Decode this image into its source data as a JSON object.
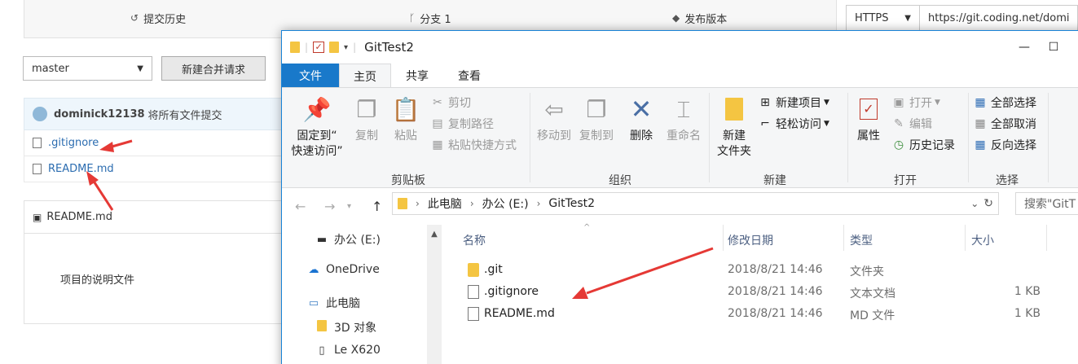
{
  "web": {
    "tabs": [
      {
        "icon": "history-icon",
        "label": "提交历史"
      },
      {
        "icon": "branch-icon",
        "label": "分支 1"
      },
      {
        "icon": "tag-icon",
        "label": "发布版本"
      }
    ],
    "clone": {
      "protocol": "HTTPS",
      "url": "https://git.coding.net/domi"
    },
    "branch_select": "master",
    "merge_request_button": "新建合并请求",
    "commit": {
      "user": "dominick12138",
      "message": "将所有文件提交"
    },
    "files": [
      ".gitignore",
      "README.md"
    ],
    "readme": {
      "title": "README.md",
      "body": "项目的说明文件"
    }
  },
  "explorer": {
    "title": "GitTest2",
    "window_buttons": {
      "minimize": "—",
      "maximize": "☐"
    },
    "ribbon_tabs": [
      "文件",
      "主页",
      "共享",
      "查看"
    ],
    "clipboard": {
      "pin_label_1": "固定到“",
      "pin_label_2": "快速访问”",
      "copy": "复制",
      "paste": "粘贴",
      "cut": "剪切",
      "copy_path": "复制路径",
      "paste_shortcut": "粘贴快捷方式",
      "group": "剪贴板"
    },
    "organize": {
      "move_to": "移动到",
      "copy_to": "复制到",
      "delete": "删除",
      "rename": "重命名",
      "group": "组织"
    },
    "new": {
      "new_folder_1": "新建",
      "new_folder_2": "文件夹",
      "new_item": "新建项目",
      "easy_access": "轻松访问",
      "group": "新建"
    },
    "open": {
      "properties": "属性",
      "open": "打开",
      "edit": "编辑",
      "history": "历史记录",
      "group": "打开"
    },
    "select": {
      "select_all": "全部选择",
      "select_none": "全部取消",
      "invert": "反向选择",
      "group": "选择"
    },
    "address": {
      "segments": [
        "此电脑",
        "办公 (E:)",
        "GitTest2"
      ]
    },
    "search_placeholder": "搜索\"GitT",
    "nav": [
      "办公 (E:)",
      "OneDrive",
      "此电脑",
      "3D 对象",
      "Le X620"
    ],
    "columns": [
      "名称",
      "修改日期",
      "类型",
      "大小"
    ],
    "rows": [
      {
        "icon": "folder",
        "name": ".git",
        "date": "2018/8/21 14:46",
        "type": "文件夹",
        "size": ""
      },
      {
        "icon": "doc",
        "name": ".gitignore",
        "date": "2018/8/21 14:46",
        "type": "文本文档",
        "size": "1 KB"
      },
      {
        "icon": "doc",
        "name": "README.md",
        "date": "2018/8/21 14:46",
        "type": "MD 文件",
        "size": "1 KB"
      }
    ],
    "colors": {
      "accent": "#1979ca",
      "ribbon_bg": "#f5f6f7",
      "arrow": "#e53935"
    }
  }
}
